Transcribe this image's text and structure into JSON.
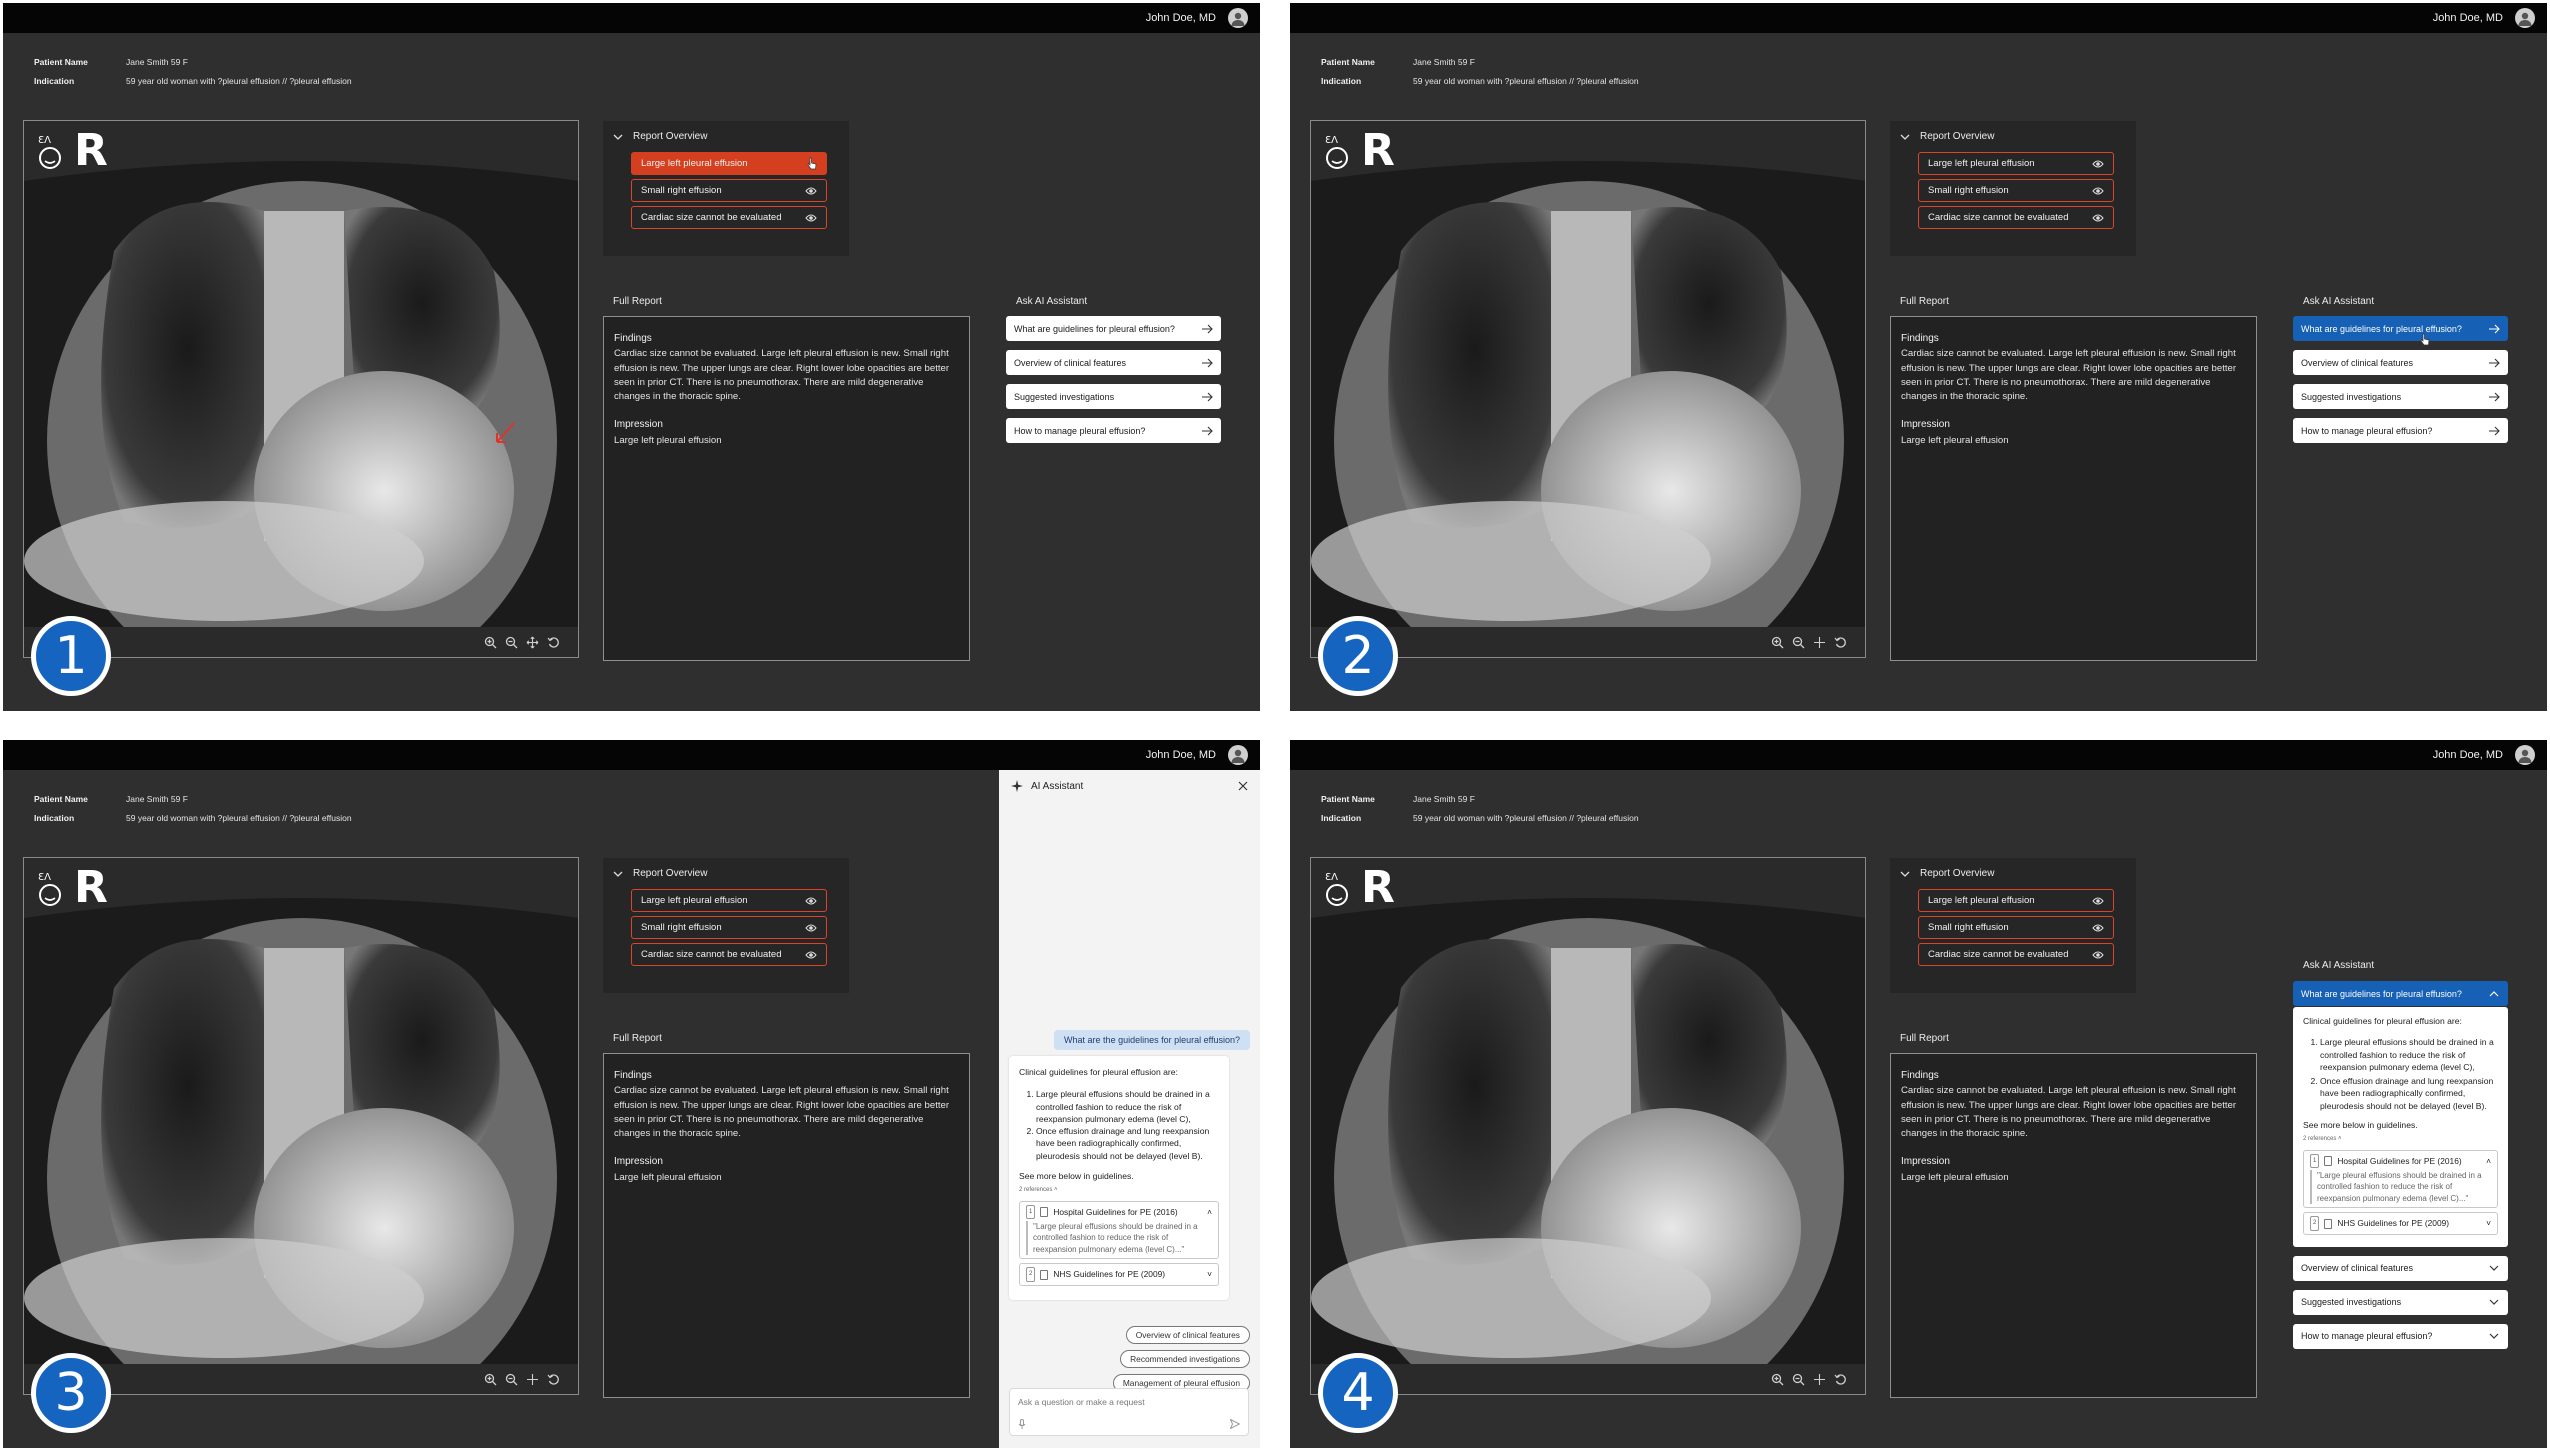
{
  "user": {
    "name": "John Doe, MD"
  },
  "patient": {
    "name_label": "Patient Name",
    "name_value": "Jane Smith 59 F",
    "indication_label": "Indication",
    "indication_value": "59 year old woman with ?pleural effusion // ?pleural effusion"
  },
  "xray": {
    "side_marker": "R"
  },
  "report_overview": {
    "title": "Report Overview",
    "items": [
      {
        "label": "Large left pleural effusion"
      },
      {
        "label": "Small right effusion"
      },
      {
        "label": "Cardiac size cannot be evaluated"
      }
    ]
  },
  "full_report": {
    "title": "Full Report",
    "findings_label": "Findings",
    "findings_text": "Cardiac size cannot be evaluated. Large left pleural effusion is new. Small right effusion is new. The upper lungs are clear. Right lower lobe opacities are better seen in prior CT. There is no pneumothorax. There are mild degenerative changes in the thoracic spine.",
    "impression_label": "Impression",
    "impression_text": "Large left pleural effusion"
  },
  "ask_ai": {
    "title": "Ask AI Assistant",
    "questions": [
      {
        "label": "What are guidelines for pleural effusion?"
      },
      {
        "label": "Overview of clinical features"
      },
      {
        "label": "Suggested investigations"
      },
      {
        "label": "How to manage pleural effusion?"
      }
    ]
  },
  "response": {
    "intro": "Clinical guidelines for pleural effusion are:",
    "points": [
      "Large pleural effusions should be drained in a controlled fashion to reduce the risk of reexpansion pulmonary edema (level C),",
      "Once effusion drainage and lung reexpansion have been radiographically confirmed, pleurodesis should not be delayed (level B)."
    ],
    "see_more": "See more below in guidelines.",
    "refs_label": "2 references",
    "refs": [
      {
        "num": "1",
        "title": "Hospital Guidelines for PE (2016)",
        "quote": "\"Large pleural effusions should be drained in a controlled fashion to reduce the risk of reexpansion pulmonary edema (level C)...\""
      },
      {
        "num": "2",
        "title": "NHS Guidelines for PE (2009)"
      }
    ]
  },
  "drawer": {
    "title": "AI Assistant",
    "user_question": "What are the guidelines for pleural effusion?",
    "chips": [
      "Overview of clinical features",
      "Recommended investigations",
      "Management of pleural effusion"
    ],
    "input_placeholder": "Ask a question or make a request"
  },
  "steps": [
    "1",
    "2",
    "3",
    "4"
  ],
  "colors": {
    "accent_red": "#d4401f",
    "accent_blue": "#1660b5",
    "step_blue": "#1565c0"
  },
  "icons": [
    "eye-icon",
    "arrow-right-icon",
    "chevron-down-icon",
    "chevron-up-icon",
    "zoom-in-icon",
    "zoom-out-icon",
    "pan-icon",
    "reset-icon",
    "sparkle-icon",
    "close-icon",
    "mic-icon",
    "send-icon",
    "document-icon",
    "avatar-icon"
  ]
}
